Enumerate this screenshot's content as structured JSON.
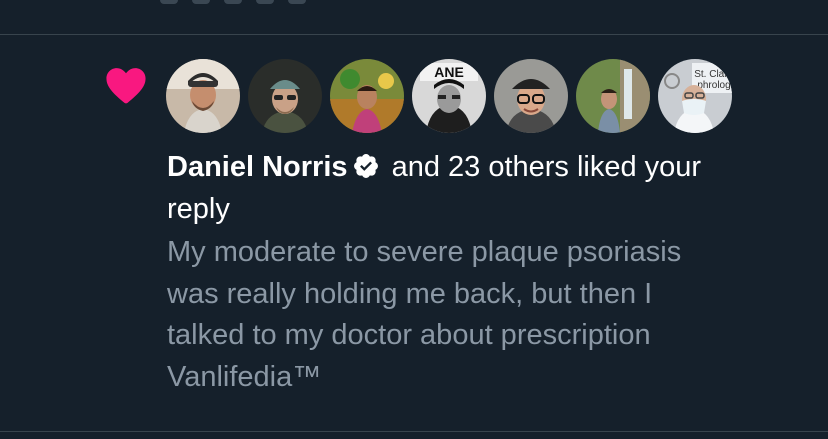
{
  "notification": {
    "liker_name": "Daniel Norris",
    "headline_rest": "and 23 others liked your",
    "headline_end": "reply",
    "verified_icon": "verified-badge-icon",
    "heart_icon": "heart-icon",
    "heart_color": "#f91880",
    "tweet_lines": [
      "My moderate to severe plaque psoriasis",
      "was really holding me back, but then I",
      "talked to my doctor about prescription",
      "Vanlifedia™"
    ],
    "avatars": [
      {
        "name": "avatar-1",
        "icon": "person-cap-avatar"
      },
      {
        "name": "avatar-2",
        "icon": "person-beanie-avatar"
      },
      {
        "name": "avatar-3",
        "icon": "person-cartoon-avatar"
      },
      {
        "name": "avatar-4",
        "icon": "person-bw-sign-avatar"
      },
      {
        "name": "avatar-5",
        "icon": "person-glasses-avatar"
      },
      {
        "name": "avatar-6",
        "icon": "person-waterfall-avatar"
      },
      {
        "name": "avatar-7",
        "icon": "person-mask-avatar",
        "sign_text": "St. Clair\nphrolog"
      }
    ]
  },
  "colors": {
    "background": "#15202b",
    "text_primary": "#ffffff",
    "text_secondary": "#8b98a5",
    "divider": "#38444d"
  }
}
